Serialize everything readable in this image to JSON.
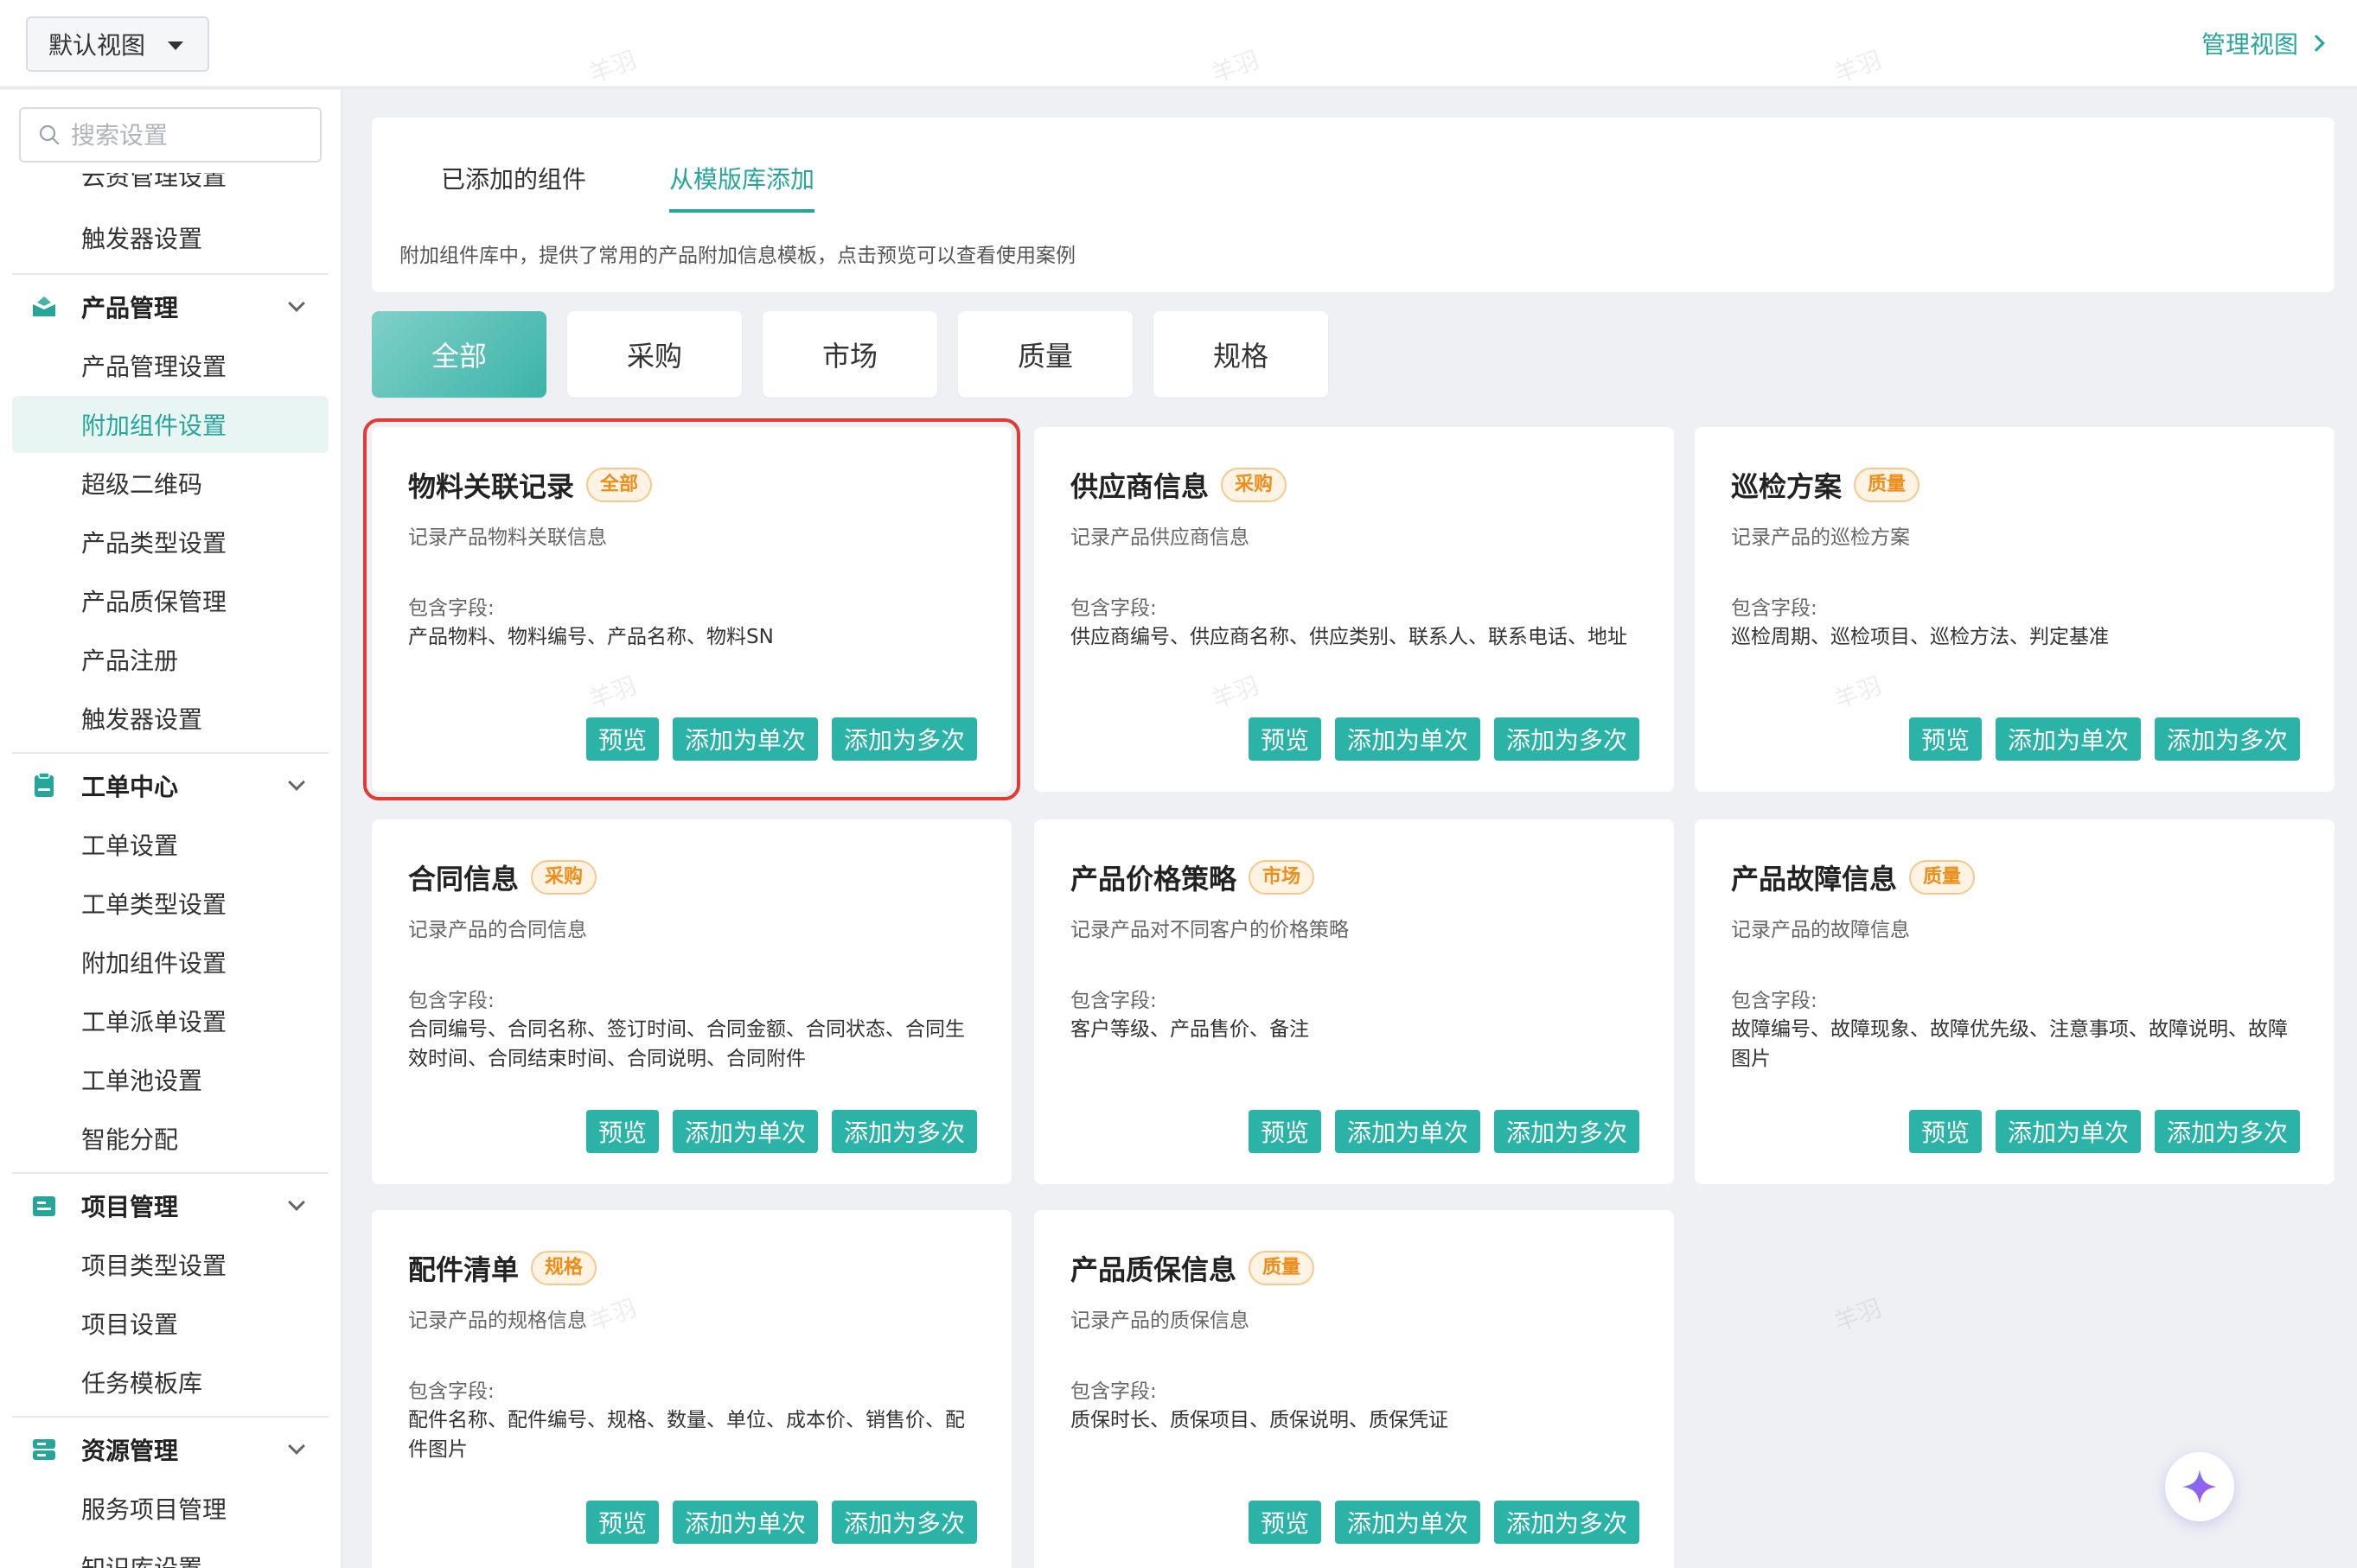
{
  "topbar": {
    "view_select_label": "默认视图",
    "manage_view_label": "管理视图"
  },
  "sidebar": {
    "search_placeholder": "搜索设置",
    "cut_top_item": "云资管理设置",
    "items_before": [
      "触发器设置"
    ],
    "groups": [
      {
        "name": "product",
        "label": "产品管理",
        "items": [
          "产品管理设置",
          "附加组件设置",
          "超级二维码",
          "产品类型设置",
          "产品质保管理",
          "产品注册",
          "触发器设置"
        ]
      },
      {
        "name": "workorder",
        "label": "工单中心",
        "items": [
          "工单设置",
          "工单类型设置",
          "附加组件设置",
          "工单派单设置",
          "工单池设置",
          "智能分配"
        ]
      },
      {
        "name": "project",
        "label": "项目管理",
        "items": [
          "项目类型设置",
          "项目设置",
          "任务模板库"
        ]
      },
      {
        "name": "resource",
        "label": "资源管理",
        "items": [
          "服务项目管理",
          "知识库设置"
        ]
      }
    ],
    "active_item": "附加组件设置"
  },
  "main": {
    "tabs": [
      {
        "label": "已添加的组件",
        "active": false
      },
      {
        "label": "从模版库添加",
        "active": true
      }
    ],
    "description": "附加组件库中，提供了常用的产品附加信息模板，点击预览可以查看使用案例",
    "filters": [
      {
        "label": "全部",
        "active": true
      },
      {
        "label": "采购",
        "active": false
      },
      {
        "label": "市场",
        "active": false
      },
      {
        "label": "质量",
        "active": false
      },
      {
        "label": "规格",
        "active": false
      }
    ],
    "fields_label": "包含字段:",
    "buttons": {
      "preview": "预览",
      "add_single": "添加为单次",
      "add_multi": "添加为多次"
    },
    "cards": [
      {
        "title": "物料关联记录",
        "tag": "全部",
        "desc": "记录产品物料关联信息",
        "fields": "产品物料、物料编号、产品名称、物料SN",
        "selected": true
      },
      {
        "title": "供应商信息",
        "tag": "采购",
        "desc": "记录产品供应商信息",
        "fields": "供应商编号、供应商名称、供应类别、联系人、联系电话、地址",
        "selected": false
      },
      {
        "title": "巡检方案",
        "tag": "质量",
        "desc": "记录产品的巡检方案",
        "fields": "巡检周期、巡检项目、巡检方法、判定基准",
        "selected": false
      },
      {
        "title": "合同信息",
        "tag": "采购",
        "desc": "记录产品的合同信息",
        "fields": "合同编号、合同名称、签订时间、合同金额、合同状态、合同生效时间、合同结束时间、合同说明、合同附件",
        "selected": false
      },
      {
        "title": "产品价格策略",
        "tag": "市场",
        "desc": "记录产品对不同客户的价格策略",
        "fields": "客户等级、产品售价、备注",
        "selected": false
      },
      {
        "title": "产品故障信息",
        "tag": "质量",
        "desc": "记录产品的故障信息",
        "fields": "故障编号、故障现象、故障优先级、注意事项、故障说明、故障图片",
        "selected": false
      },
      {
        "title": "配件清单",
        "tag": "规格",
        "desc": "记录产品的规格信息",
        "fields": "配件名称、配件编号、规格、数量、单位、成本价、销售价、配件图片",
        "selected": false
      },
      {
        "title": "产品质保信息",
        "tag": "质量",
        "desc": "记录产品的质保信息",
        "fields": "质保时长、质保项目、质保说明、质保凭证",
        "selected": false
      }
    ]
  },
  "watermark_text": "羊羽",
  "colors": {
    "accent": "#26a69a",
    "tag_orange": "#f08c1a",
    "selected_outline": "#e53935"
  },
  "icons": {
    "search": "search-icon",
    "fab": "sparkle-icon",
    "groups": [
      "box-icon",
      "clipboard-icon",
      "kanban-icon",
      "database-icon"
    ]
  }
}
